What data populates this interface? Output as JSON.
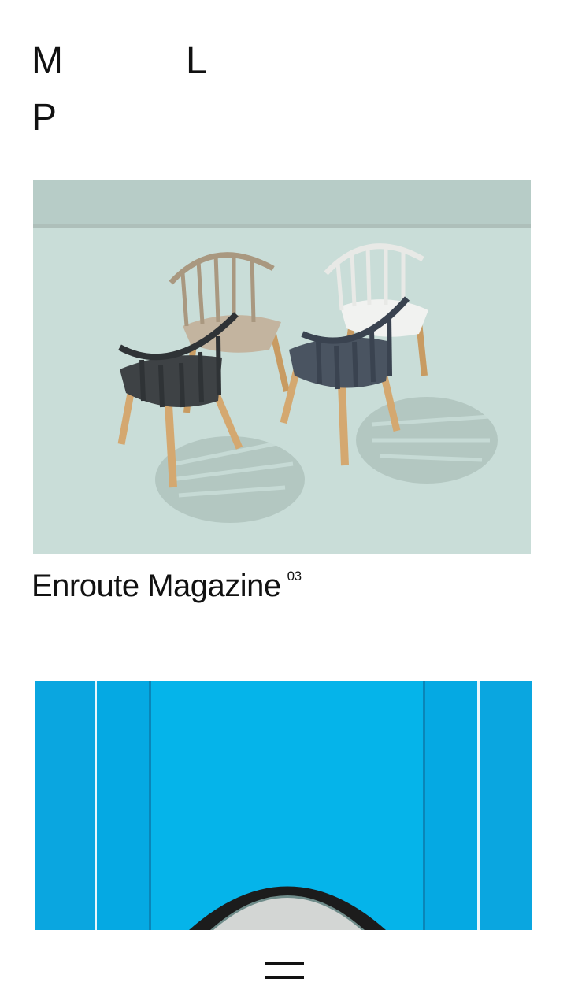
{
  "logo": {
    "letter_1": "M",
    "letter_2": "L",
    "letter_3": "P"
  },
  "projects": [
    {
      "title": "Enroute Magazine",
      "number": "03",
      "image_icon": "chairs-photo",
      "colors": {
        "background": "#c9ddd8",
        "wall": "#b8cdc8"
      }
    },
    {
      "image_icon": "blue-wall-photo",
      "colors": {
        "background": "#00aee8",
        "accent": "#1a1a1a"
      }
    }
  ],
  "menu": {
    "icon": "hamburger-menu-icon"
  }
}
